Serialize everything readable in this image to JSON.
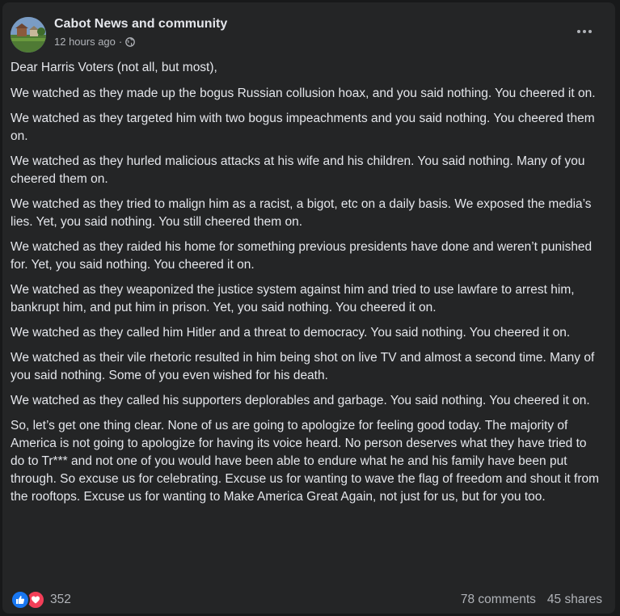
{
  "post": {
    "page_name": "Cabot News and community",
    "timestamp": "12 hours ago",
    "separator": "·",
    "privacy_icon": "globe-icon",
    "more_icon": "more-dots-icon",
    "paragraphs": [
      "Dear Harris Voters (not all, but most),",
      "We watched as they made up the bogus Russian collusion hoax, and you said nothing. You cheered it on.",
      "We watched as they targeted him with two bogus impeachments and you said nothing. You cheered them on.",
      "We watched as they hurled malicious attacks at his wife and his children. You said nothing. Many of you cheered them on.",
      "We watched as they tried to malign him as a racist, a bigot, etc on a daily basis. We exposed the media’s lies. Yet, you said nothing. You still cheered them on.",
      "We watched as they raided his home for something previous presidents have done and weren’t punished for. Yet, you said nothing. You cheered it on.",
      "We watched as they weaponized the justice system against him and tried to use lawfare to arrest him, bankrupt him, and put him in prison. Yet, you said nothing. You cheered it on.",
      "We watched as they called him Hitler and a threat to democracy. You said nothing. You cheered it on.",
      "We watched as their vile rhetoric resulted in him being shot on live TV and almost a second time. Many of you said nothing. Some of you even wished for his death.",
      "We watched as they called his supporters deplorables and garbage. You said nothing. You cheered it on.",
      "So, let’s get one thing clear. None of us are going to apologize for feeling good today. The majority of America is not going to apologize for having its voice heard. No person deserves what they have tried to do to Tr*** and not one of you would have been able to endure what he and his family have been put through. So excuse us for celebrating. Excuse us for wanting to wave the flag of freedom and shout it from the rooftops. Excuse us for wanting to Make America Great Again, not just for us, but for you too."
    ],
    "reactions": {
      "icons": [
        "like-icon",
        "love-icon"
      ],
      "count": "352"
    },
    "comments": "78 comments",
    "shares": "45 shares"
  },
  "colors": {
    "card_background": "#242526",
    "page_background": "#18191a",
    "primary_text": "#e4e6eb",
    "secondary_text": "#b0b3b8",
    "like_blue": "#1877f2",
    "love_red": "#f33e58"
  }
}
